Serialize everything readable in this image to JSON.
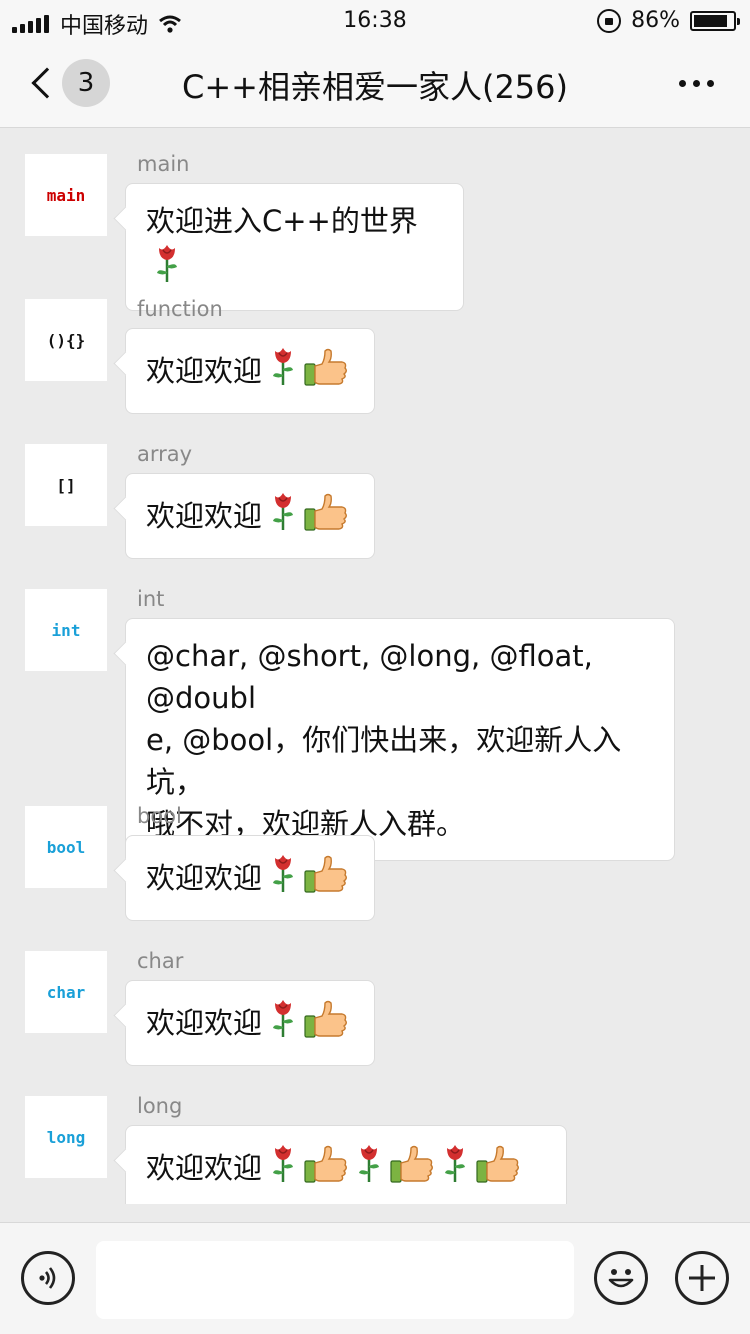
{
  "status": {
    "carrier": "中国移动",
    "time": "16:38",
    "battery": "86%",
    "battery_level": 0.86
  },
  "header": {
    "unread_count": "3",
    "title": "C++相亲相爱一家人(256)"
  },
  "messages": [
    {
      "sender": "main",
      "avatar_text": "main",
      "avatar_color": "#cc0000",
      "text": "欢迎进入C++的世界",
      "emojis": [
        "rose"
      ]
    },
    {
      "sender": "function",
      "avatar_text": "(){}",
      "avatar_color": "#111111",
      "text": "欢迎欢迎",
      "emojis": [
        "rose",
        "thumbs-up"
      ]
    },
    {
      "sender": "array",
      "avatar_text": "[]",
      "avatar_color": "#111111",
      "text": "欢迎欢迎",
      "emojis": [
        "rose",
        "thumbs-up"
      ]
    },
    {
      "sender": "int",
      "avatar_text": "int",
      "avatar_color": "#1aa0d8",
      "text_lines": [
        "@char, @short, @long, @float, @doubl",
        "e, @bool，你们快出来，欢迎新人入坑，",
        "哦不对，欢迎新人入群。"
      ]
    },
    {
      "sender": "bool",
      "avatar_text": "bool",
      "avatar_color": "#1aa0d8",
      "text": "欢迎欢迎",
      "emojis": [
        "rose",
        "thumbs-up"
      ]
    },
    {
      "sender": "char",
      "avatar_text": "char",
      "avatar_color": "#1aa0d8",
      "text": "欢迎欢迎",
      "emojis": [
        "rose",
        "thumbs-up"
      ]
    },
    {
      "sender": "long",
      "avatar_text": "long",
      "avatar_color": "#1aa0d8",
      "text": "欢迎欢迎",
      "emojis": [
        "rose",
        "thumbs-up",
        "rose",
        "thumbs-up",
        "rose",
        "thumbs-up"
      ]
    }
  ],
  "input": {
    "value": "",
    "placeholder": ""
  },
  "icons": {
    "voice": "voice-icon",
    "emoji": "emoji-icon",
    "plus": "plus-icon"
  }
}
